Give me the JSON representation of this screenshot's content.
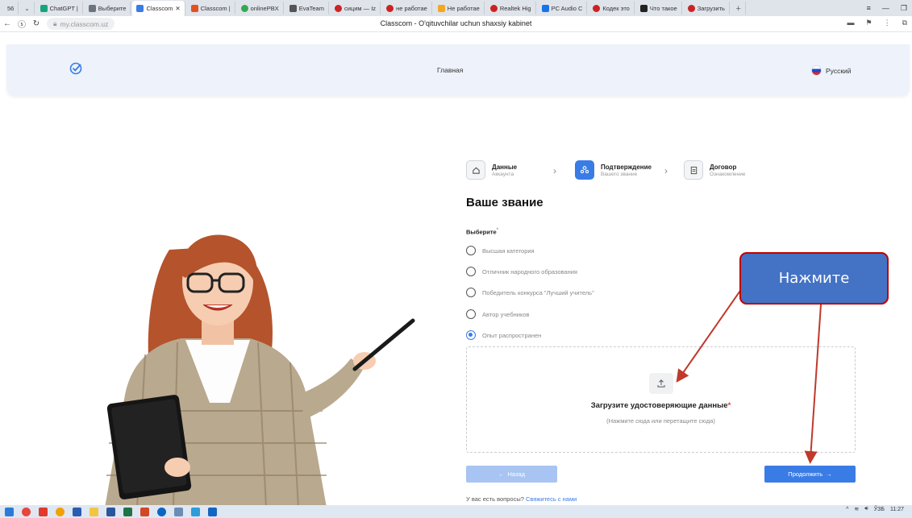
{
  "browser": {
    "tab_count": "56",
    "tabs": [
      {
        "label": "ChatGPT |",
        "color": "#18a37f"
      },
      {
        "label": "Выберите",
        "color": "#6c757d"
      },
      {
        "label": "Classcom",
        "color": "#3a7ce6",
        "active": true
      },
      {
        "label": "Classcom |",
        "color": "#e0531f"
      },
      {
        "label": "onlinePBX",
        "color": "#34a853"
      },
      {
        "label": "EvaTeam",
        "color": "#555555"
      },
      {
        "label": "сицим — Iz",
        "color": "#cc2222"
      },
      {
        "label": "не работае",
        "color": "#cc2222"
      },
      {
        "label": "Не работае",
        "color": "#f5a623"
      },
      {
        "label": "Realtek Hig",
        "color": "#cc2222"
      },
      {
        "label": "PC Audio C",
        "color": "#1a73e8"
      },
      {
        "label": "Кодек это",
        "color": "#cc2222"
      },
      {
        "label": "Что такое",
        "color": "#222222"
      },
      {
        "label": "Загрузить",
        "color": "#cc2222"
      }
    ],
    "url": "my.classcom.uz",
    "page_title": "Classcom - O'qituvchilar uchun shaxsiy kabinet"
  },
  "header": {
    "nav_home": "Главная",
    "language": "Русский"
  },
  "stepper": {
    "steps": [
      {
        "title": "Данные",
        "subtitle": "Аккаунта"
      },
      {
        "title": "Подтверждение",
        "subtitle": "Вашего звание"
      },
      {
        "title": "Договор",
        "subtitle": "Ознакомление"
      }
    ]
  },
  "form": {
    "title": "Ваше звание",
    "select_label": "Выберите",
    "options": [
      "Высшая категория",
      "Отличник народного образования",
      "Победитель конкурса \"Лучший учитель\"",
      "Автор учебников",
      "Опыт распространен"
    ],
    "selected_index": 4,
    "upload_title": "Загрузите удостоверяющие данные",
    "upload_required_mark": "*",
    "upload_hint": "(Нажмите сюда или перетащите сюда)",
    "back_label": "Назад",
    "continue_label": "Продолжить",
    "question_text": "У вас есть вопросы?",
    "contact_link": "Свяжитесь с нами"
  },
  "annotation": {
    "callout_text": "Нажмите"
  },
  "taskbar": {
    "time": "11:27",
    "lang": "ЎЗБ"
  },
  "colors": {
    "primary": "#3a7ce6",
    "callout_fill": "#4472c4",
    "callout_border": "#c00000",
    "arrow": "#c0392b"
  }
}
